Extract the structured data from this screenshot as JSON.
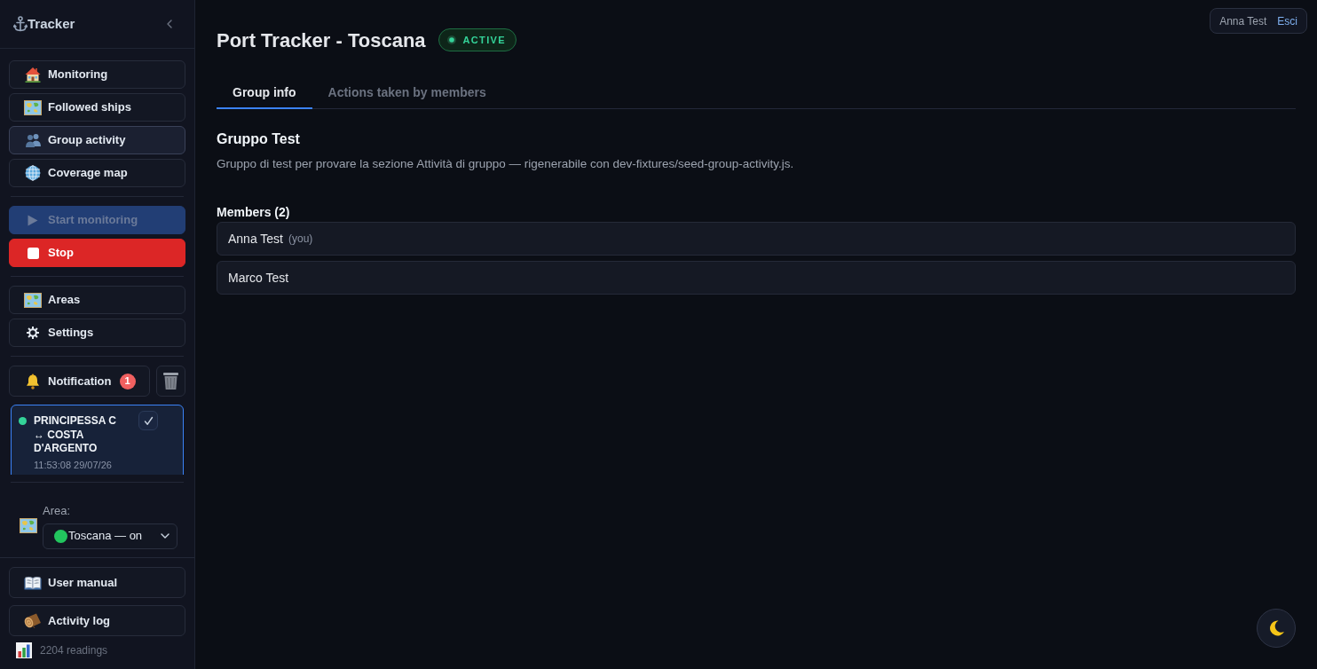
{
  "sidebar": {
    "brand": "Tracker",
    "nav": [
      {
        "label": "Monitoring",
        "selected": false
      },
      {
        "label": "Followed ships",
        "selected": false
      },
      {
        "label": "Group activity",
        "selected": true
      },
      {
        "label": "Coverage map",
        "selected": false
      }
    ],
    "monitoring_controls": [
      {
        "kind": "start",
        "label": "Start monitoring",
        "disabled": true
      },
      {
        "kind": "stop",
        "label": "Stop",
        "disabled": false
      }
    ],
    "tools": [
      {
        "label": "Areas"
      },
      {
        "label": "Settings"
      }
    ],
    "notifications": {
      "label": "Notification",
      "count": "1",
      "items": [
        {
          "title": "PRINCIPESSA C ↔ COSTA D'ARGENTO",
          "time": "11:53:08 29/07/26",
          "color": "#34d399"
        }
      ]
    },
    "area": {
      "label": "Area:",
      "value": "Toscana — on"
    },
    "footer": [
      {
        "label": "User manual"
      },
      {
        "label": "Activity log"
      }
    ],
    "readings": "2204 readings"
  },
  "user_menu": {
    "name": "Anna Test",
    "logout": "Esci"
  },
  "page": {
    "title": "Port Tracker - Toscana",
    "status": "ACTIVE",
    "tabs": [
      {
        "label": "Group info",
        "selected": true
      },
      {
        "label": "Actions taken by members",
        "selected": false
      }
    ],
    "group": {
      "name": "Gruppo Test",
      "description": "Gruppo di test per provare la sezione Attività di gruppo — rigenerabile con dev-fixtures/seed-group-activity.js."
    },
    "members": {
      "heading": "Members (2)",
      "items": [
        {
          "name": "Anna Test",
          "note": "(you)"
        },
        {
          "name": "Marco Test"
        }
      ]
    }
  }
}
